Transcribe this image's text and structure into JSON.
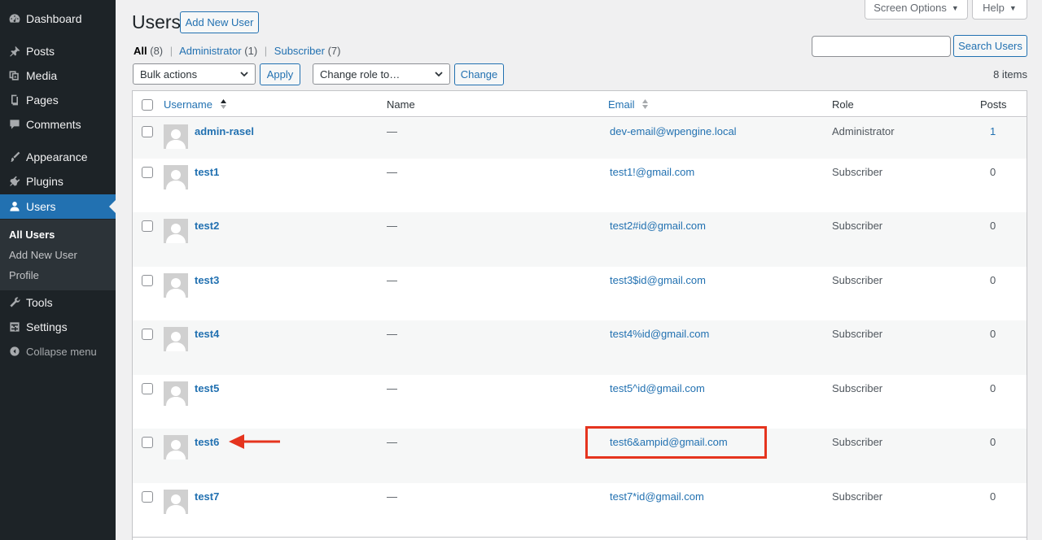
{
  "sidebar": {
    "items": [
      {
        "label": "Dashboard",
        "icon": "dashboard-icon"
      },
      {
        "label": "Posts",
        "icon": "pushpin-icon"
      },
      {
        "label": "Media",
        "icon": "media-icon"
      },
      {
        "label": "Pages",
        "icon": "pages-icon"
      },
      {
        "label": "Comments",
        "icon": "comment-icon"
      },
      {
        "label": "Appearance",
        "icon": "paintbrush-icon"
      },
      {
        "label": "Plugins",
        "icon": "plugin-icon"
      },
      {
        "label": "Users",
        "icon": "user-icon"
      },
      {
        "label": "Tools",
        "icon": "wrench-icon"
      },
      {
        "label": "Settings",
        "icon": "settings-icon"
      }
    ],
    "users_submenu": [
      "All Users",
      "Add New User",
      "Profile"
    ],
    "collapse_label": "Collapse menu"
  },
  "header": {
    "screen_options": "Screen Options",
    "help": "Help",
    "title": "Users",
    "add_new": "Add New User"
  },
  "filters": {
    "all_label": "All",
    "all_count": "(8)",
    "admin_label": "Administrator",
    "admin_count": "(1)",
    "subscriber_label": "Subscriber",
    "subscriber_count": "(7)"
  },
  "search": {
    "value": "",
    "button": "Search Users"
  },
  "bulk": {
    "bulk_actions": "Bulk actions",
    "apply": "Apply",
    "change_role": "Change role to…",
    "change": "Change",
    "items_count": "8 items"
  },
  "table": {
    "columns": {
      "username": "Username",
      "name": "Name",
      "email": "Email",
      "role": "Role",
      "posts": "Posts"
    },
    "rows": [
      {
        "username": "admin-rasel",
        "name": "—",
        "email": "dev-email@wpengine.local",
        "role": "Administrator",
        "posts": "1"
      },
      {
        "username": "test1",
        "name": "—",
        "email": "test1!@gmail.com",
        "role": "Subscriber",
        "posts": "0"
      },
      {
        "username": "test2",
        "name": "—",
        "email": "test2#id@gmail.com",
        "role": "Subscriber",
        "posts": "0"
      },
      {
        "username": "test3",
        "name": "—",
        "email": "test3$id@gmail.com",
        "role": "Subscriber",
        "posts": "0"
      },
      {
        "username": "test4",
        "name": "—",
        "email": "test4%id@gmail.com",
        "role": "Subscriber",
        "posts": "0"
      },
      {
        "username": "test5",
        "name": "—",
        "email": "test5^id@gmail.com",
        "role": "Subscriber",
        "posts": "0"
      },
      {
        "username": "test6",
        "name": "—",
        "email": "test6&ampid@gmail.com",
        "role": "Subscriber",
        "posts": "0"
      },
      {
        "username": "test7",
        "name": "—",
        "email": "test7*id@gmail.com",
        "role": "Subscriber",
        "posts": "0"
      }
    ]
  },
  "colors": {
    "accent": "#2271b1",
    "sidebar_bg": "#1d2327",
    "annotation": "#e5341e"
  }
}
